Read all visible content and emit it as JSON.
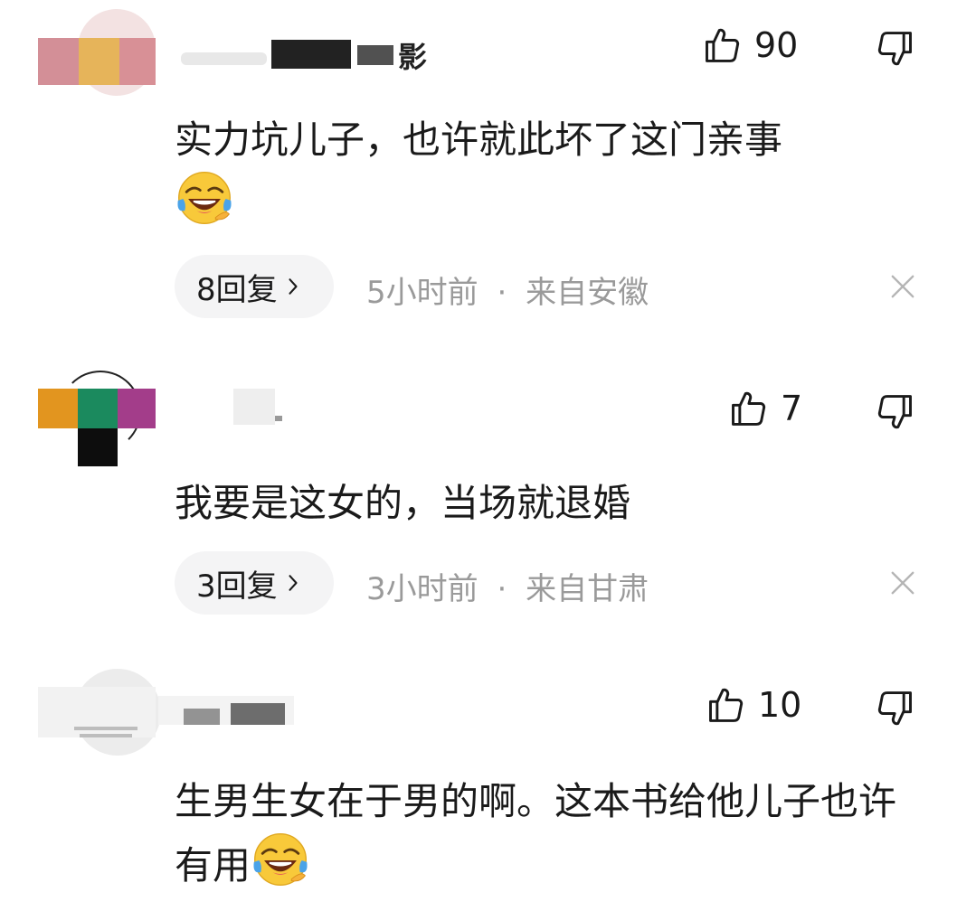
{
  "comments": [
    {
      "username": "影",
      "likes": "90",
      "text": "实力坑儿子，也许就此坏了这门亲事",
      "emoji": "laughing-crying-emoji",
      "replies": "8回复",
      "time": "5小时前",
      "location": "来自安徽",
      "separator": "·"
    },
    {
      "username": "",
      "likes": "7",
      "text": "我要是这女的，当场就退婚",
      "emoji": "",
      "replies": "3回复",
      "time": "3小时前",
      "location": "来自甘肃",
      "separator": "·"
    },
    {
      "username": "",
      "likes": "10",
      "text": "生男生女在于男的啊。这本书给他儿子也许有用",
      "emoji": "laughing-crying-emoji",
      "replies": "",
      "time": "",
      "location": "",
      "separator": ""
    }
  ],
  "icons": {
    "like": "thumbs-up-icon",
    "dislike": "thumbs-down-icon",
    "chevron": "chevron-right-icon",
    "close": "close-icon"
  },
  "colors": {
    "text": "#1a1a1a",
    "meta": "#9a9a9a",
    "pill_bg": "#f4f4f5",
    "close": "#b5b5b5"
  }
}
